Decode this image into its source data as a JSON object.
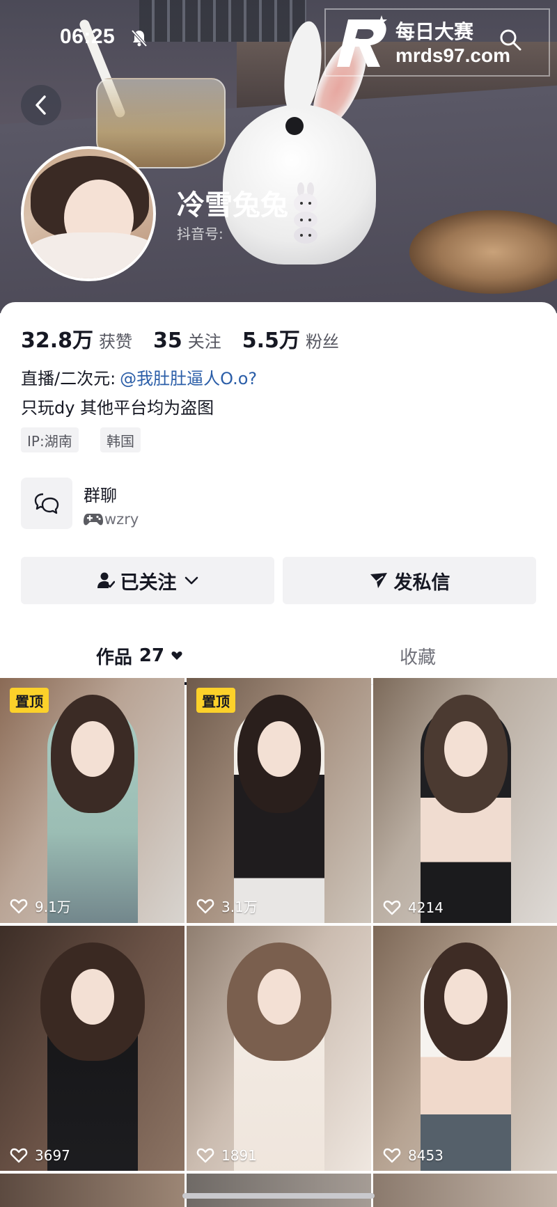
{
  "status_bar": {
    "time": "06:25"
  },
  "watermark": {
    "title": "每日大赛",
    "url": "mrds97.com"
  },
  "profile": {
    "name": "冷雪兔兔",
    "douyin_id_label": "抖音号:",
    "stats": [
      {
        "value": "32.8万",
        "label": "获赞"
      },
      {
        "value": "35",
        "label": "关注"
      },
      {
        "value": "5.5万",
        "label": "粉丝"
      }
    ],
    "bio_prefix": "直播/二次元:",
    "bio_mention": "@我肚肚逼人O.o?",
    "bio_line2": "只玩dy 其他平台均为盗图",
    "tags": [
      "IP:湖南",
      "韩国"
    ]
  },
  "group": {
    "title": "群聊",
    "subtitle": "wzry"
  },
  "actions": {
    "follow_label": "已关注",
    "message_label": "发私信"
  },
  "tabs": {
    "works_label": "作品",
    "works_count": "27",
    "favorites_label": "收藏"
  },
  "posts": [
    {
      "likes": "9.1万",
      "pinned": true,
      "pin_label": "置顶"
    },
    {
      "likes": "3.1万",
      "pinned": true,
      "pin_label": "置顶"
    },
    {
      "likes": "4214",
      "pinned": false
    },
    {
      "likes": "3697",
      "pinned": false
    },
    {
      "likes": "1891",
      "pinned": false
    },
    {
      "likes": "8453",
      "pinned": false
    }
  ],
  "colors": {
    "mention": "#2b5ea8",
    "pin_badge": "#fcd12a",
    "text": "#161823",
    "button_bg": "#f2f2f4"
  }
}
